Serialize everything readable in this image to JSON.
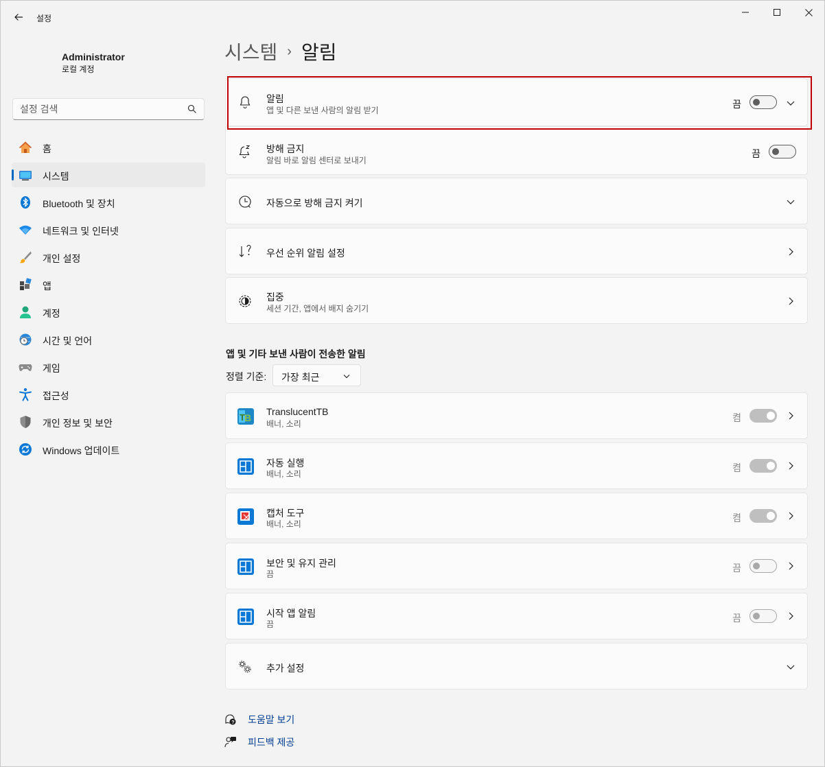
{
  "window": {
    "title": "설정"
  },
  "profile": {
    "name": "Administrator",
    "account_type": "로컬 계정"
  },
  "search": {
    "placeholder": "설정 검색"
  },
  "sidebar": {
    "items": [
      {
        "label": "홈",
        "icon": "home-icon"
      },
      {
        "label": "시스템",
        "icon": "system-icon",
        "active": true
      },
      {
        "label": "Bluetooth 및 장치",
        "icon": "bluetooth-icon"
      },
      {
        "label": "네트워크 및 인터넷",
        "icon": "wifi-icon"
      },
      {
        "label": "개인 설정",
        "icon": "brush-icon"
      },
      {
        "label": "앱",
        "icon": "apps-icon"
      },
      {
        "label": "계정",
        "icon": "account-icon"
      },
      {
        "label": "시간 및 언어",
        "icon": "globe-clock-icon"
      },
      {
        "label": "게임",
        "icon": "gamepad-icon"
      },
      {
        "label": "접근성",
        "icon": "accessibility-icon"
      },
      {
        "label": "개인 정보 및 보안",
        "icon": "shield-icon"
      },
      {
        "label": "Windows 업데이트",
        "icon": "update-icon"
      }
    ]
  },
  "breadcrumb": {
    "parent": "시스템",
    "separator": "›",
    "current": "알림"
  },
  "settings": {
    "notifications": {
      "title": "알림",
      "subtitle": "앱 및 다른 보낸 사람의 알림 받기",
      "state": "끔",
      "icon": "bell-icon"
    },
    "dnd": {
      "title": "방해 금지",
      "subtitle": "알림 바로 알림 센터로 보내기",
      "state": "끔",
      "icon": "bell-zz-icon"
    },
    "auto_dnd": {
      "title": "자동으로 방해 금지 켜기",
      "icon": "clock-icon"
    },
    "priority": {
      "title": "우선 순위 알림 설정",
      "icon": "priority-sort-icon"
    },
    "focus": {
      "title": "집중",
      "subtitle": "세션 기간, 앱에서 배지 숨기기",
      "icon": "focus-icon"
    }
  },
  "apps_section": {
    "title": "앱 및 기타 보낸 사람이 전송한 알림",
    "sort_label": "정렬 기준:",
    "sort_value": "가장 최근",
    "apps": [
      {
        "name": "TranslucentTB",
        "detail": "배너, 소리",
        "state": "켬",
        "on": true,
        "icon": "translucenttb-icon"
      },
      {
        "name": "자동 실행",
        "detail": "배너, 소리",
        "state": "켬",
        "on": true,
        "icon": "app-tile-icon"
      },
      {
        "name": "캡처 도구",
        "detail": "배너, 소리",
        "state": "켬",
        "on": true,
        "icon": "snipping-tool-icon"
      },
      {
        "name": "보안 및 유지 관리",
        "detail": "끔",
        "state": "끔",
        "on": false,
        "icon": "app-tile-icon"
      },
      {
        "name": "시작 앱 알림",
        "detail": "끔",
        "state": "끔",
        "on": false,
        "icon": "app-tile-icon"
      }
    ],
    "more": {
      "title": "추가 설정",
      "icon": "gears-icon"
    }
  },
  "footer": {
    "help": "도움말 보기",
    "feedback": "피드백 제공"
  },
  "colors": {
    "accent": "#0067c0",
    "highlight": "#c00000"
  }
}
